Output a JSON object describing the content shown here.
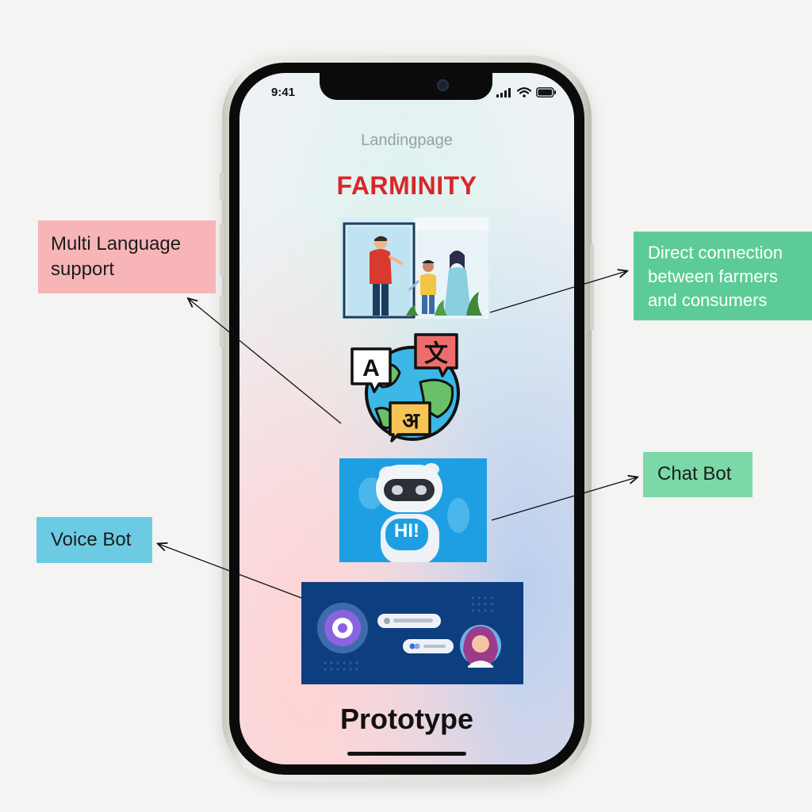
{
  "status_bar": {
    "time": "9:41"
  },
  "screen": {
    "subtitle": "Landingpage",
    "app_title": "FARMINITY",
    "chat_bot_greeting": "HI!",
    "translate_glyphs": {
      "latin": "A",
      "chinese": "文",
      "hindi": "अ"
    },
    "footer_title": "Prototype"
  },
  "callouts": {
    "multi_language": "Multi Language support",
    "direct_connection": "Direct connection between farmers and consumers",
    "chat_bot": "Chat Bot",
    "voice_bot": "Voice Bot"
  },
  "colors": {
    "brand_red": "#d8262a",
    "callout_pink": "#f7b5b8",
    "callout_green": "#5dcb97",
    "callout_mint": "#7ad9a7",
    "callout_blue": "#6ccbe3",
    "chatbot_bg": "#1e9fe3",
    "voicebot_bg": "#0d3f80"
  },
  "icons": [
    "signal-icon",
    "wifi-icon",
    "battery-icon",
    "globe-translate-icon",
    "robot-icon",
    "voice-orb-icon",
    "avatar"
  ]
}
